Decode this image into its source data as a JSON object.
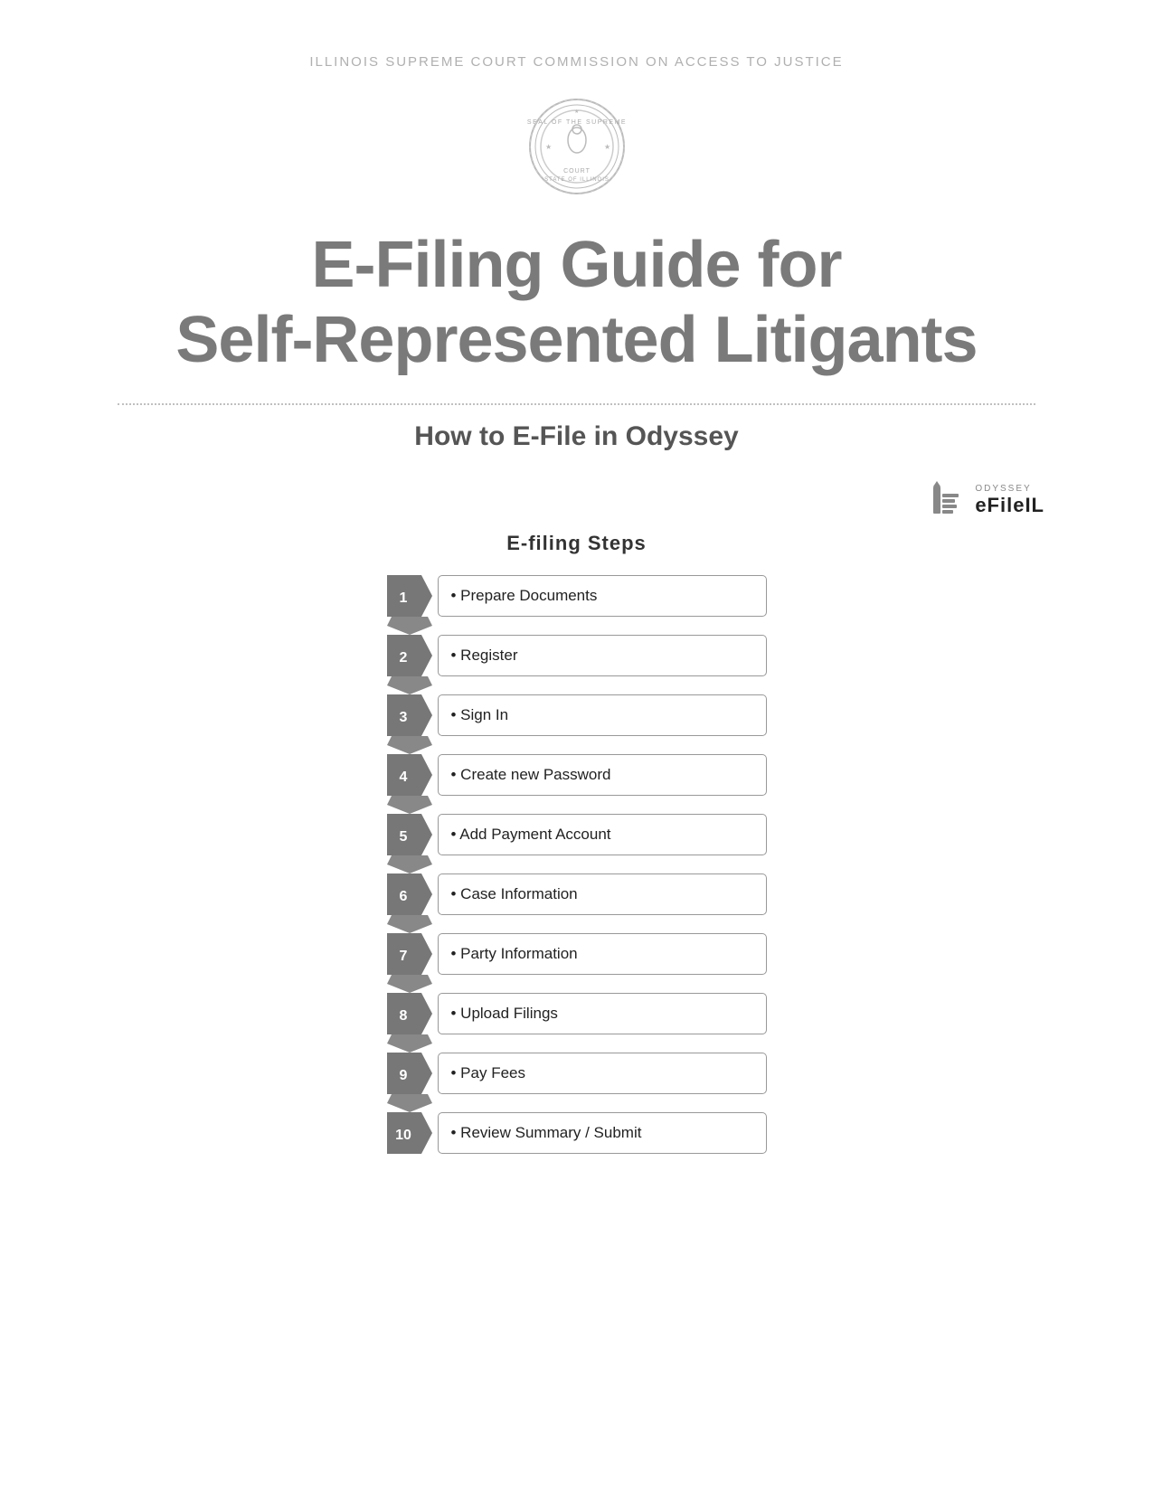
{
  "header": {
    "org_name": "ILLINOIS SUPREME COURT COMMISSION ON ACCESS TO JUSTICE",
    "main_title_line1": "E-Filing Guide for",
    "main_title_line2": "Self-Represented Litigants",
    "subtitle": "How to E-File in Odyssey",
    "odyssey_label": "ODYSSEY",
    "efile_label": "eFileIL",
    "steps_heading": "E-filing Steps"
  },
  "steps": [
    {
      "number": "1",
      "label": "Prepare Documents"
    },
    {
      "number": "2",
      "label": "Register"
    },
    {
      "number": "3",
      "label": "Sign In"
    },
    {
      "number": "4",
      "label": "Create new Password"
    },
    {
      "number": "5",
      "label": "Add Payment Account"
    },
    {
      "number": "6",
      "label": "Case Information"
    },
    {
      "number": "7",
      "label": "Party Information"
    },
    {
      "number": "8",
      "label": "Upload Filings"
    },
    {
      "number": "9",
      "label": "Pay Fees"
    },
    {
      "number": "10",
      "label": "Review Summary / Submit"
    }
  ]
}
